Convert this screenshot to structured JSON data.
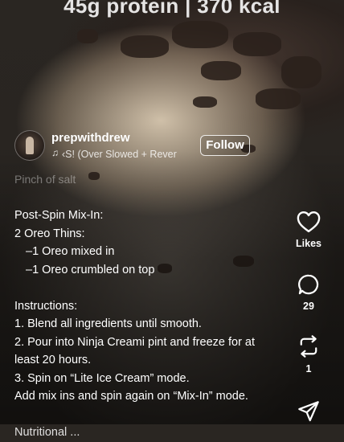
{
  "banner": {
    "text": "45g protein | 370 kcal"
  },
  "profile": {
    "username": "prepwithdrew",
    "music_icon": "music-note-icon",
    "music_text": "‹S! (Over Slowed + Rever",
    "follow_label": "Follow"
  },
  "caption": {
    "faded_line": "Pinch of salt",
    "lines": [
      "Post-Spin Mix-In:",
      "2 Oreo Thins:",
      "–1 Oreo mixed in",
      "–1 Oreo crumbled on top",
      "",
      "Instructions:",
      "1. Blend all ingredients until smooth.",
      "2. Pour into Ninja Creami pint and freeze for at",
      "least 20 hours.",
      "3. Spin on “Lite Ice Cream” mode.",
      "Add mix ins and spin again on “Mix-In” mode.",
      "",
      "Nutritional ..."
    ]
  },
  "actions": {
    "like": {
      "icon": "heart-icon",
      "label": "Likes"
    },
    "comment": {
      "icon": "comment-icon",
      "count": "29"
    },
    "repost": {
      "icon": "repost-icon",
      "count": "1"
    },
    "share": {
      "icon": "send-icon"
    }
  }
}
